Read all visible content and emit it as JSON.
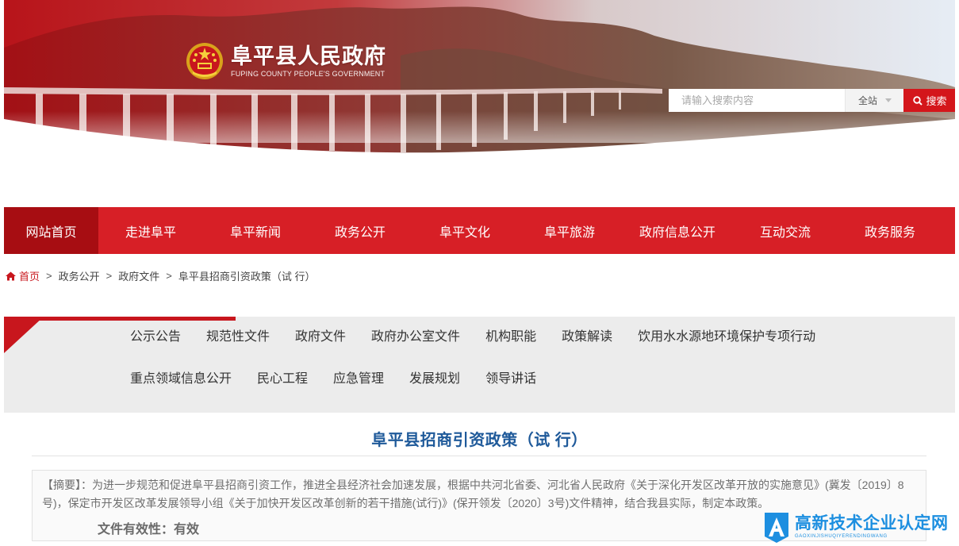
{
  "header": {
    "site_name": "阜平县人民政府",
    "site_name_en": "FUPING COUNTY PEOPLE'S GOVERNMENT",
    "search": {
      "placeholder": "请输入搜索内容",
      "scope": "全站",
      "button_label": "搜索"
    }
  },
  "nav": {
    "items": [
      {
        "label": "网站首页",
        "active": true
      },
      {
        "label": "走进阜平"
      },
      {
        "label": "阜平新闻"
      },
      {
        "label": "政务公开"
      },
      {
        "label": "阜平文化"
      },
      {
        "label": "阜平旅游"
      },
      {
        "label": "政府信息公开"
      },
      {
        "label": "互动交流"
      },
      {
        "label": "政务服务"
      }
    ]
  },
  "breadcrumb": {
    "items": [
      "首页",
      "政务公开",
      "政府文件",
      "阜平县招商引资政策（试 行）"
    ],
    "separator": ">"
  },
  "subnav": {
    "row1": [
      "公示公告",
      "规范性文件",
      "政府文件",
      "政府办公室文件",
      "机构职能",
      "政策解读",
      "饮用水水源地环境保护专项行动"
    ],
    "row2": [
      "重点领域信息公开",
      "民心工程",
      "应急管理",
      "发展规划",
      "领导讲话"
    ]
  },
  "article": {
    "title": "阜平县招商引资政策（试 行）",
    "abstract_label": "【摘要】：",
    "abstract_text": "为进一步规范和促进阜平县招商引资工作，推进全县经济社会加速发展，根据中共河北省委、河北省人民政府《关于深化开发区改革开放的实施意见》(冀发〔2019〕8号)，保定市开发区改革发展领导小组《关于加快开发区改革创新的若干措施(试行)》(保开领发〔2020〕3号)文件精神，结合我县实际，制定本政策。",
    "validity": "文件有效性：有效"
  },
  "watermark": {
    "cn": "高新技术企业认定网",
    "en": "GAOXINJISHUQIYERENDINGWANG"
  },
  "colors": {
    "primary_red": "#d71f26",
    "active_red": "#a70d12",
    "title_blue": "#1f5a9a",
    "watermark_blue": "#1d8fe0"
  },
  "icons": [
    "national-emblem-icon",
    "search-icon",
    "home-icon",
    "caret-down-icon",
    "watermark-logo-icon"
  ]
}
